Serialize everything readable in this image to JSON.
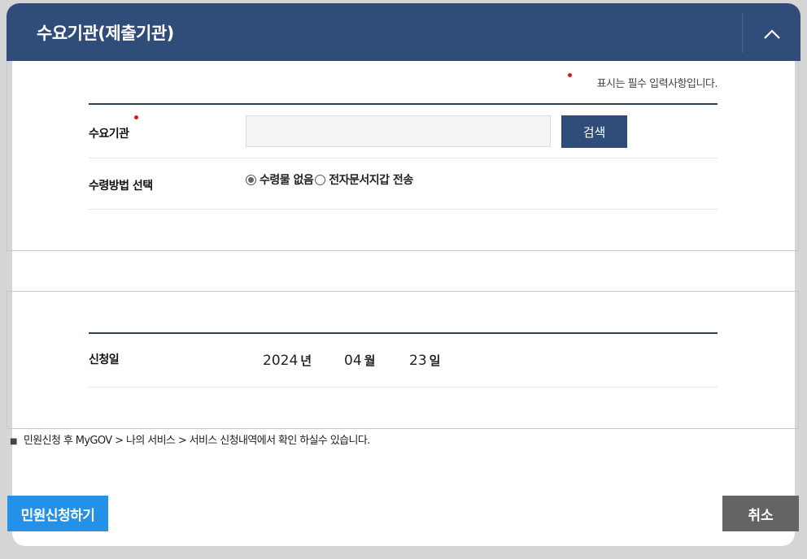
{
  "header": {
    "title": "수요기관(제출기관)",
    "collapse_icon": "chevron-up-icon"
  },
  "required_note": "표시는 필수 입력사항입니다.",
  "form": {
    "agency_label": "수요기관",
    "agency_value": "",
    "search_label": "검색",
    "method_label": "수령방법 선택",
    "method_options": [
      "수령물 없음",
      "전자문서지갑 전송"
    ],
    "method_selected": "수령물 없음"
  },
  "date": {
    "label": "신청일",
    "year": "2024",
    "year_unit": "년",
    "month": "04",
    "month_unit": "월",
    "day": "23",
    "day_unit": "일"
  },
  "info_note": "민원신청 후 MyGOV > 나의 서비스 > 서비스 신청내역에서 확인 하실수 있습니다.",
  "buttons": {
    "submit": "민원신청하기",
    "cancel": "취소"
  },
  "colors": {
    "header": "#304d7a",
    "required": "#e0141e",
    "submit": "#2391e8",
    "cancel": "#646464"
  }
}
